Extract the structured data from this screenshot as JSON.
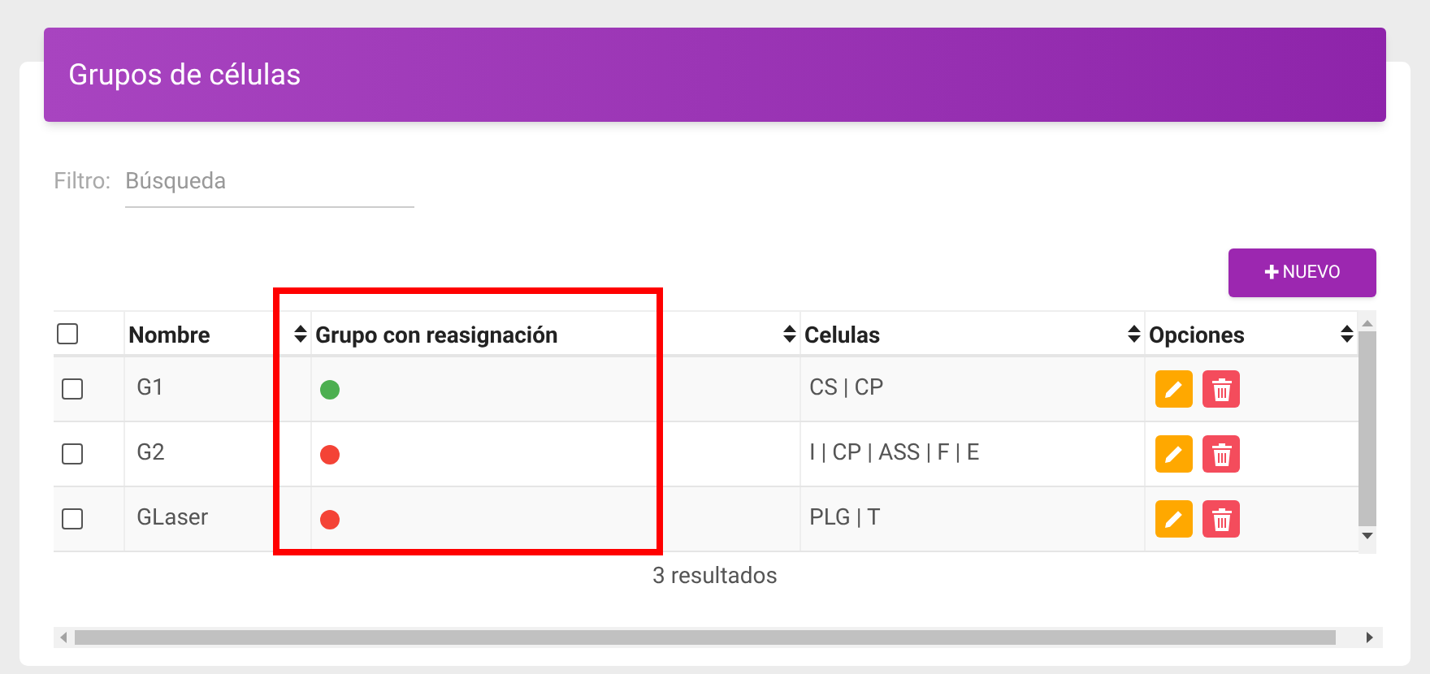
{
  "header": {
    "title": "Grupos de células"
  },
  "filter": {
    "label": "Filtro:",
    "placeholder": "Búsqueda"
  },
  "new_button": {
    "icon": "+",
    "label": "NUEVO"
  },
  "table": {
    "select_all": {
      "checked": false
    },
    "columns": [
      {
        "label": "Nombre"
      },
      {
        "label": "Grupo con reasignación"
      },
      {
        "label": "Celulas"
      },
      {
        "label": "Opciones"
      }
    ],
    "rows": [
      {
        "checked": false,
        "name": "G1",
        "color": "#4caf50",
        "cells": "CS | CP"
      },
      {
        "checked": false,
        "name": "G2",
        "color": "#f44336",
        "cells": "I | CP | ASS | F | E"
      },
      {
        "checked": false,
        "name": "GLaser",
        "color": "#f44336",
        "cells": "PLG | T"
      }
    ]
  },
  "result_count": "3 resultados"
}
